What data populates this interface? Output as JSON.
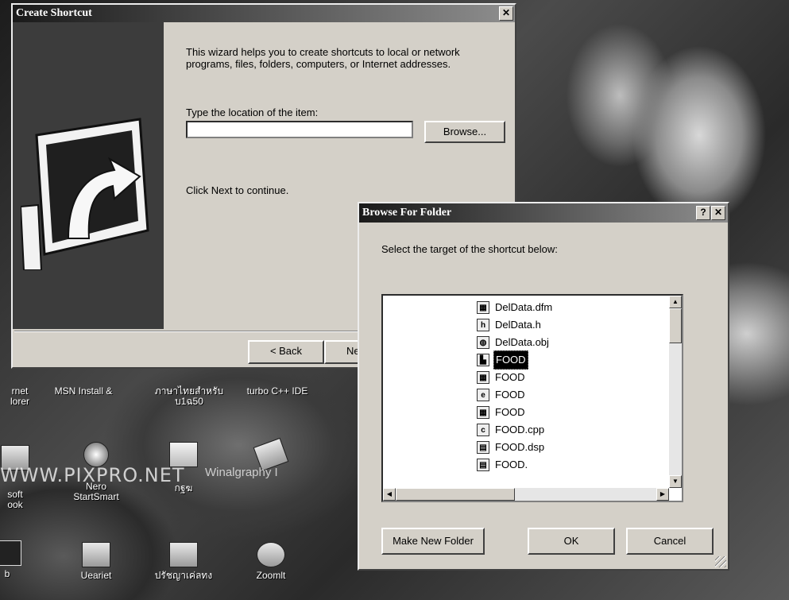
{
  "create_shortcut": {
    "title": "Create Shortcut",
    "close_glyph": "✕",
    "intro_text": "This wizard helps you to create shortcuts to local or network programs, files, folders, computers, or Internet addresses.",
    "location_label": "Type the location of the item:",
    "location_value": "",
    "browse_label": "Browse...",
    "continue_text": "Click Next to continue.",
    "back_label": "< Back",
    "next_label_partial": "Ne",
    "graphic_icon": "shortcut-arrow-icon"
  },
  "browse_dialog": {
    "title": "Browse For Folder",
    "help_glyph": "?",
    "close_glyph": "✕",
    "instruction": "Select the target of the shortcut below:",
    "tree_items": [
      {
        "name": "DelData.dfm",
        "icon": "form-file-icon",
        "glyph": "▦",
        "selected": false
      },
      {
        "name": "DelData.h",
        "icon": "header-file-icon",
        "glyph": "h",
        "selected": false
      },
      {
        "name": "DelData.obj",
        "icon": "object-file-icon",
        "glyph": "◍",
        "selected": false
      },
      {
        "name": "FOOD",
        "icon": "project-icon",
        "glyph": "▙",
        "selected": true
      },
      {
        "name": "FOOD",
        "icon": "form-file-icon",
        "glyph": "▦",
        "selected": false
      },
      {
        "name": "FOOD",
        "icon": "internet-file-icon",
        "glyph": "e",
        "selected": false
      },
      {
        "name": "FOOD",
        "icon": "form-file-icon",
        "glyph": "▦",
        "selected": false
      },
      {
        "name": "FOOD.cpp",
        "icon": "cpp-file-icon",
        "glyph": "c",
        "selected": false
      },
      {
        "name": "FOOD.dsp",
        "icon": "dsp-file-icon",
        "glyph": "▤",
        "selected": false
      },
      {
        "name": "FOOD.",
        "icon": "file-icon",
        "glyph": "▤",
        "selected": false
      }
    ],
    "make_new_folder_label": "Make New Folder",
    "ok_label": "OK",
    "cancel_label": "Cancel"
  },
  "desktop": {
    "icons_row1": [
      {
        "label": "rnet\nlorer",
        "icon": "internet-explorer-icon"
      },
      {
        "label": "MSN Install &",
        "icon": "msn-icon"
      },
      {
        "label": "ภาษาไทยสำหรับ\nบ1ฉ50",
        "icon": "shortcut-icon"
      },
      {
        "label": "turbo C++ IDE",
        "icon": "shortcut-icon"
      }
    ],
    "icons_row2": [
      {
        "label": "soft\nook",
        "icon": "outlook-icon"
      },
      {
        "label": "Nero\nStartSmart",
        "icon": "nero-icon"
      },
      {
        "label": "กฐฆ",
        "icon": "folder-icon"
      },
      {
        "label": "Winalgraphy I",
        "icon": "winalgraphy-icon"
      }
    ],
    "icons_row3": [
      {
        "label": "b",
        "icon": "app-icon"
      },
      {
        "label": "Ueariet",
        "icon": "folder-icon"
      },
      {
        "label": "ปรัชญาเค่ลทง",
        "icon": "folder-icon"
      },
      {
        "label": "Zoomlt",
        "icon": "zoomit-icon"
      }
    ],
    "watermark": "WWW.PIXPRO.NET",
    "watermark_partial": "Winalgraphy I"
  }
}
